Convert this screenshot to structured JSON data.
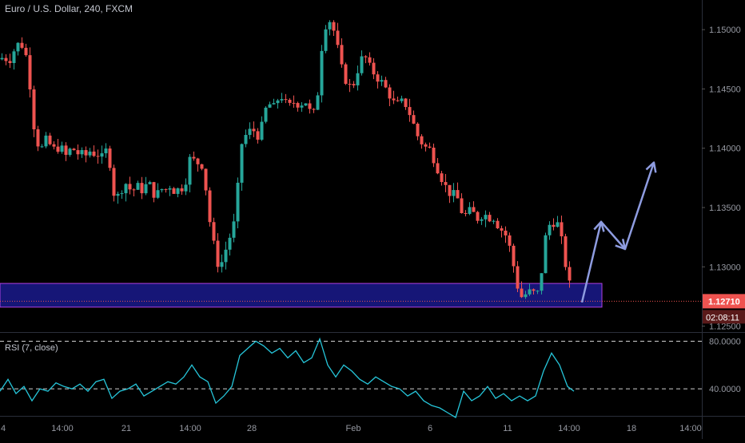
{
  "header": {
    "title": "Euro / U.S. Dollar, 240, FXCM"
  },
  "rsi": {
    "title": "RSI (7, close)",
    "levels": [
      "80.0000",
      "40.0000"
    ]
  },
  "price_axis": {
    "ticks": [
      "1.15000",
      "1.14500",
      "1.14000",
      "1.13500",
      "1.13000",
      "1.12500"
    ],
    "last_price": "1.12710",
    "countdown": "02:08:11"
  },
  "time_axis": {
    "ticks": [
      "4",
      "14:00",
      "21",
      "14:00",
      "28",
      "Feb",
      "6",
      "11",
      "14:00",
      "18",
      "14:00"
    ]
  },
  "colors": {
    "background": "#000000",
    "bull": "#26a69a",
    "bear": "#ef5350",
    "zone_fill": "#1a1a8c",
    "zone_border": "#b040e0",
    "arrow": "#8e9ce0",
    "rsi_line": "#26c6da",
    "price_label": "#ef5350"
  },
  "chart_data": [
    {
      "type": "candlestick",
      "title": "Euro / U.S. Dollar, 240, FXCM",
      "ylim": [
        1.1245,
        1.1525
      ],
      "last_price": 1.1271,
      "close_path": [
        [
          0,
          1.1475
        ],
        [
          5,
          1.1478
        ],
        [
          10,
          1.1472
        ],
        [
          15,
          1.148
        ],
        [
          20,
          1.1486
        ],
        [
          25,
          1.149
        ],
        [
          30,
          1.1482
        ],
        [
          35,
          1.1472
        ],
        [
          40,
          1.1425
        ],
        [
          45,
          1.141
        ],
        [
          50,
          1.1395
        ],
        [
          55,
          1.1408
        ],
        [
          60,
          1.1405
        ],
        [
          65,
          1.14
        ],
        [
          70,
          1.1398
        ],
        [
          75,
          1.1404
        ],
        [
          80,
          1.1392
        ],
        [
          85,
          1.1396
        ],
        [
          90,
          1.1402
        ],
        [
          95,
          1.1394
        ],
        [
          100,
          1.1398
        ],
        [
          105,
          1.139
        ],
        [
          110,
          1.14
        ],
        [
          115,
          1.1394
        ],
        [
          120,
          1.1398
        ],
        [
          125,
          1.139
        ],
        [
          130,
          1.1395
        ],
        [
          135,
          1.1402
        ],
        [
          140,
          1.1365
        ],
        [
          145,
          1.1358
        ],
        [
          150,
          1.1362
        ],
        [
          155,
          1.1372
        ],
        [
          160,
          1.1368
        ],
        [
          165,
          1.1362
        ],
        [
          170,
          1.137
        ],
        [
          175,
          1.1364
        ],
        [
          180,
          1.1366
        ],
        [
          185,
          1.1372
        ],
        [
          190,
          1.1364
        ],
        [
          195,
          1.1358
        ],
        [
          200,
          1.1368
        ],
        [
          205,
          1.1362
        ],
        [
          210,
          1.137
        ],
        [
          215,
          1.1366
        ],
        [
          220,
          1.1362
        ],
        [
          225,
          1.137
        ],
        [
          230,
          1.1362
        ],
        [
          235,
          1.139
        ],
        [
          240,
          1.1392
        ],
        [
          245,
          1.1386
        ],
        [
          250,
          1.139
        ],
        [
          255,
          1.138
        ],
        [
          260,
          1.1345
        ],
        [
          265,
          1.1328
        ],
        [
          270,
          1.1305
        ],
        [
          275,
          1.13
        ],
        [
          280,
          1.131
        ],
        [
          285,
          1.1322
        ],
        [
          290,
          1.133
        ],
        [
          295,
          1.1345
        ],
        [
          300,
          1.14
        ],
        [
          305,
          1.141
        ],
        [
          310,
          1.1412
        ],
        [
          315,
          1.1418
        ],
        [
          320,
          1.141
        ],
        [
          325,
          1.1412
        ],
        [
          330,
          1.1428
        ],
        [
          335,
          1.144
        ],
        [
          340,
          1.1432
        ],
        [
          345,
          1.1438
        ],
        [
          350,
          1.1446
        ],
        [
          355,
          1.144
        ],
        [
          360,
          1.1434
        ],
        [
          365,
          1.1438
        ],
        [
          370,
          1.144
        ],
        [
          375,
          1.1434
        ],
        [
          380,
          1.1444
        ],
        [
          385,
          1.1432
        ],
        [
          390,
          1.143
        ],
        [
          395,
          1.1428
        ],
        [
          400,
          1.1475
        ],
        [
          405,
          1.15
        ],
        [
          410,
          1.151
        ],
        [
          415,
          1.1504
        ],
        [
          420,
          1.1492
        ],
        [
          425,
          1.1472
        ],
        [
          430,
          1.146
        ],
        [
          435,
          1.1454
        ],
        [
          440,
          1.145
        ],
        [
          445,
          1.1462
        ],
        [
          450,
          1.1472
        ],
        [
          455,
          1.148
        ],
        [
          460,
          1.147
        ],
        [
          465,
          1.1466
        ],
        [
          470,
          1.146
        ],
        [
          475,
          1.1458
        ],
        [
          480,
          1.1452
        ],
        [
          485,
          1.1448
        ],
        [
          490,
          1.144
        ],
        [
          495,
          1.1436
        ],
        [
          500,
          1.1438
        ],
        [
          505,
          1.144
        ],
        [
          510,
          1.1432
        ],
        [
          515,
          1.1425
        ],
        [
          520,
          1.1412
        ],
        [
          525,
          1.1408
        ],
        [
          530,
          1.14
        ],
        [
          535,
          1.1402
        ],
        [
          540,
          1.1395
        ],
        [
          545,
          1.1386
        ],
        [
          550,
          1.1378
        ],
        [
          555,
          1.137
        ],
        [
          560,
          1.1364
        ],
        [
          565,
          1.136
        ],
        [
          570,
          1.1362
        ],
        [
          575,
          1.135
        ],
        [
          580,
          1.1342
        ],
        [
          585,
          1.1346
        ],
        [
          590,
          1.1348
        ],
        [
          595,
          1.134
        ],
        [
          600,
          1.1342
        ],
        [
          605,
          1.1346
        ],
        [
          610,
          1.134
        ],
        [
          615,
          1.1344
        ],
        [
          620,
          1.1338
        ],
        [
          625,
          1.1332
        ],
        [
          630,
          1.133
        ],
        [
          635,
          1.1322
        ],
        [
          640,
          1.1308
        ],
        [
          645,
          1.129
        ],
        [
          650,
          1.1274
        ],
        [
          655,
          1.1276
        ],
        [
          660,
          1.1278
        ],
        [
          665,
          1.128
        ],
        [
          670,
          1.1275
        ],
        [
          675,
          1.1282
        ],
        [
          680,
          1.1318
        ],
        [
          685,
          1.1335
        ],
        [
          690,
          1.1336
        ],
        [
          695,
          1.134
        ],
        [
          700,
          1.133
        ],
        [
          705,
          1.131
        ],
        [
          710,
          1.129
        ],
        [
          715,
          1.1278
        ],
        [
          718,
          1.1271
        ]
      ]
    },
    {
      "type": "line",
      "title": "RSI (7, close)",
      "ylim": [
        20,
        85
      ],
      "levels": [
        80,
        40
      ],
      "x": [
        0,
        10,
        20,
        30,
        40,
        50,
        60,
        70,
        80,
        90,
        100,
        110,
        120,
        130,
        140,
        150,
        160,
        170,
        180,
        190,
        200,
        210,
        220,
        230,
        240,
        250,
        260,
        270,
        280,
        290,
        300,
        310,
        320,
        330,
        340,
        350,
        360,
        370,
        380,
        390,
        400,
        410,
        420,
        430,
        440,
        450,
        460,
        470,
        480,
        490,
        500,
        510,
        520,
        530,
        540,
        550,
        560,
        570,
        580,
        590,
        600,
        610,
        620,
        630,
        640,
        650,
        660,
        670,
        680,
        690,
        700,
        710,
        718
      ],
      "values": [
        38,
        48,
        36,
        42,
        30,
        40,
        38,
        45,
        42,
        40,
        44,
        38,
        46,
        48,
        32,
        38,
        40,
        44,
        34,
        38,
        42,
        46,
        44,
        50,
        60,
        50,
        46,
        28,
        34,
        42,
        68,
        74,
        80,
        76,
        70,
        74,
        66,
        72,
        62,
        66,
        82,
        60,
        50,
        60,
        55,
        48,
        44,
        50,
        46,
        42,
        40,
        34,
        38,
        30,
        26,
        24,
        20,
        16,
        38,
        30,
        34,
        42,
        32,
        36,
        30,
        34,
        30,
        34,
        55,
        70,
        60,
        42,
        38
      ]
    }
  ],
  "annotations": {
    "support_zone": {
      "from": 1.1266,
      "to": 1.1286
    },
    "projection": [
      [
        728,
        1.127
      ],
      [
        752,
        1.1338
      ],
      [
        782,
        1.1315
      ],
      [
        818,
        1.1388
      ]
    ]
  }
}
